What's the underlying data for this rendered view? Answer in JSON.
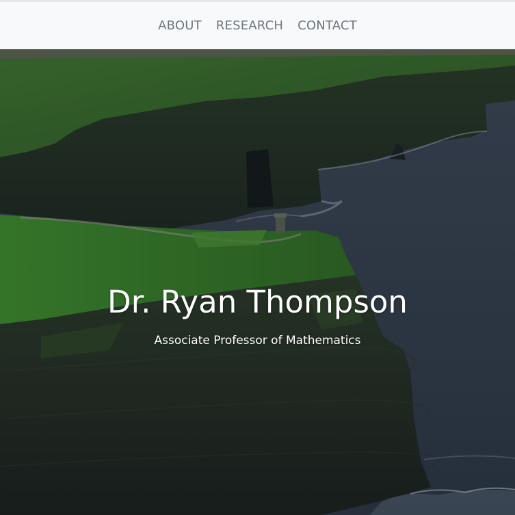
{
  "nav": {
    "items": [
      {
        "label": "ABOUT"
      },
      {
        "label": "RESEARCH"
      },
      {
        "label": "CONTACT"
      }
    ]
  },
  "hero": {
    "title": "Dr. Ryan Thompson",
    "subtitle": "Associate Professor of Mathematics",
    "background_image": "coastal-cliffs-photo"
  },
  "colors": {
    "nav_background": "#f8f9fa",
    "nav_text": "#6c757d",
    "hero_text": "#ffffff",
    "sea": "#3a4654",
    "grass": "#3f7a2c",
    "cliff": "#232826"
  }
}
